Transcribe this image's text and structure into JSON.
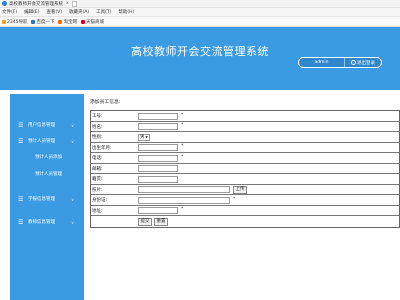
{
  "browser": {
    "tab_title": "高校教师开会交流管理系统",
    "tab_close": "x",
    "menu": [
      "文件(F)",
      "编辑(E)",
      "查看(V)",
      "收藏夹(A)",
      "工具(T)",
      "帮助(H)"
    ],
    "favorites": [
      "2345导航",
      "百度一下",
      "淘宝网",
      "天猫商城"
    ]
  },
  "header": {
    "title": "高校教师开会交流管理系统",
    "user": "admin",
    "logout": "退出登录"
  },
  "sidebar": {
    "items": [
      {
        "label": "用户信息管理"
      },
      {
        "label": "预计人员管理"
      },
      {
        "label": "学报信息管理"
      },
      {
        "label": "教师信息管理"
      }
    ],
    "subitems": [
      "预计人员添加",
      "预计人员管理"
    ]
  },
  "form": {
    "heading": "添加员工信息:",
    "rows": [
      {
        "label": "工号:",
        "required": "*"
      },
      {
        "label": "姓名:",
        "required": "*"
      },
      {
        "label": "性别:",
        "value": "男"
      },
      {
        "label": "出生年月:",
        "required": "*"
      },
      {
        "label": "电话:",
        "required": "*"
      },
      {
        "label": "邮箱:"
      },
      {
        "label": "籍贯:"
      },
      {
        "label": "照片:"
      },
      {
        "label": "身份证:",
        "required": "*"
      },
      {
        "label": "地址:",
        "required": "*"
      }
    ],
    "upload_label": "上传",
    "submit_label": "提交",
    "reset_label": "重置"
  },
  "colors": {
    "header_bg": "#3a9ae2",
    "sidebar_bg": "#3a9ae2"
  }
}
